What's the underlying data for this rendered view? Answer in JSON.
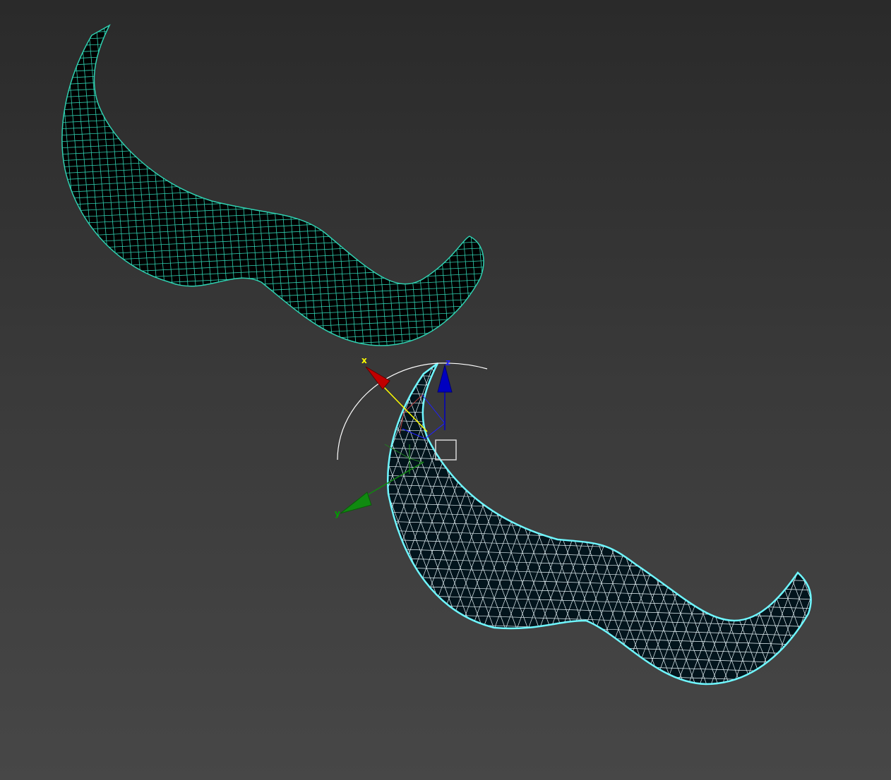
{
  "viewport": {
    "background_top": "#2a2a2a",
    "background_bottom": "#474747"
  },
  "objects": [
    {
      "name": "mustache-quad-mesh",
      "wire_color": "#2fd0b0",
      "fill_color": "#000000",
      "selected": false
    },
    {
      "name": "mustache-triangulated-mesh",
      "wire_color": "#e8f4f8",
      "outline_color": "#6ff7ff",
      "fill_color": "#02141c",
      "selected": true
    }
  ],
  "gizmo": {
    "axes": {
      "x": {
        "label": "x",
        "label_color": "#ffff00",
        "arrow_color": "#c00000"
      },
      "y": {
        "label": "y",
        "label_color": "#00a000",
        "arrow_color": "#108a10"
      },
      "z": {
        "label": "z",
        "label_color": "#2020ff",
        "arrow_color": "#0000c0"
      }
    },
    "rotation_arc_color": "#ffffff",
    "center_box_color": "#d8d8d8"
  }
}
